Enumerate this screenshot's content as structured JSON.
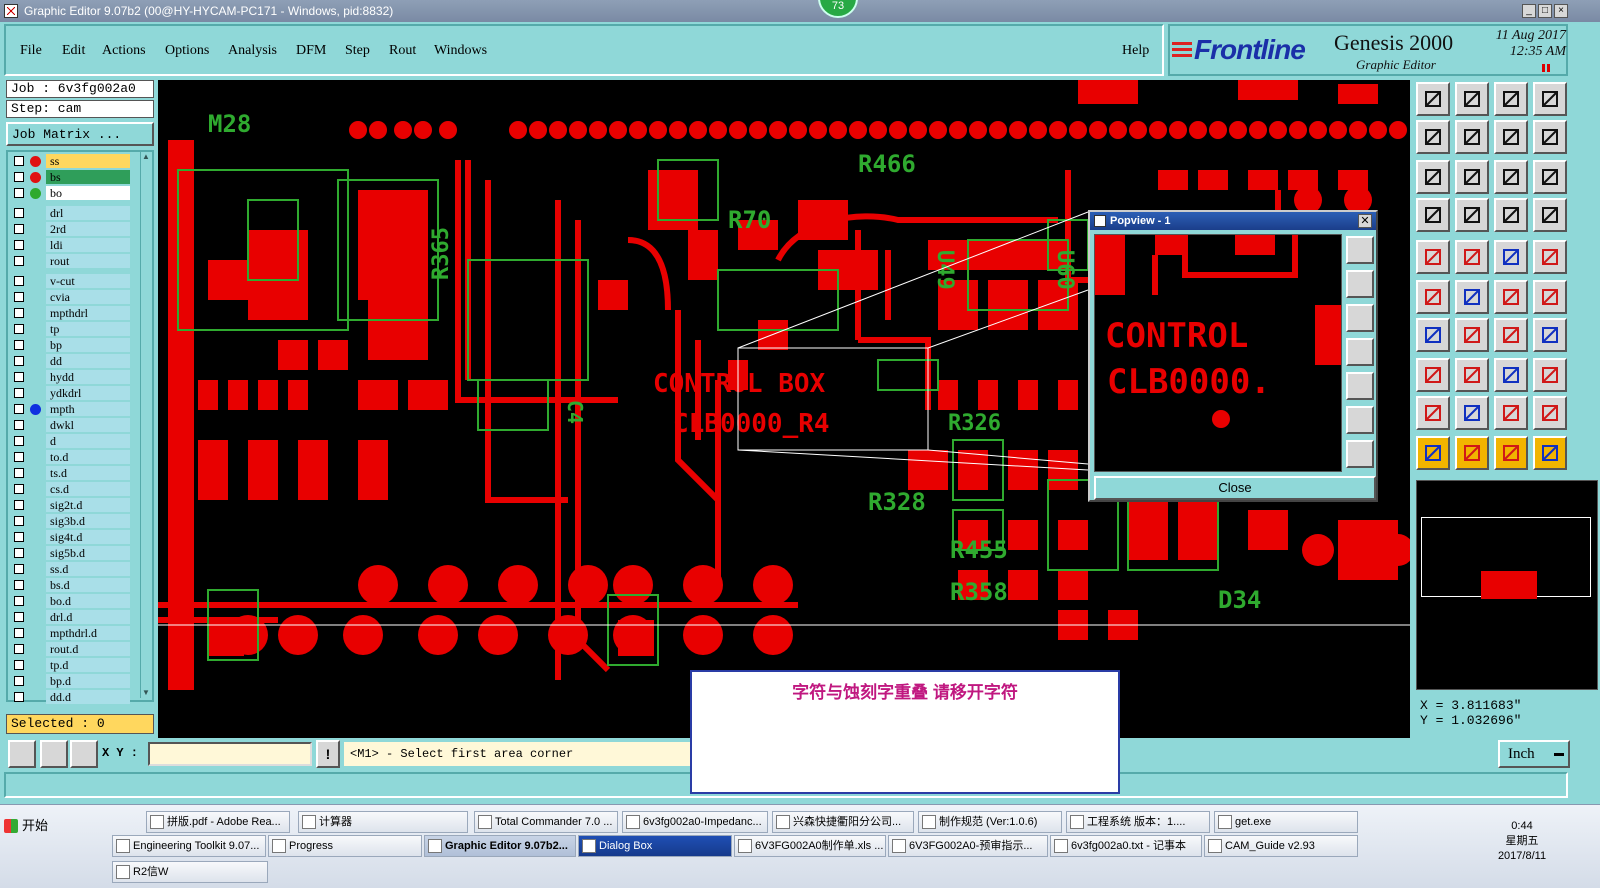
{
  "window": {
    "title": "Graphic Editor 9.07b2 (00@HY-HYCAM-PC171 - Windows, pid:8832)",
    "badge": "73"
  },
  "menu": {
    "items": [
      "File",
      "Edit",
      "Actions",
      "Options",
      "Analysis",
      "DFM",
      "Step",
      "Rout",
      "Windows"
    ],
    "help": "Help"
  },
  "logo": {
    "brand": "Frontline",
    "product": "Genesis 2000",
    "subtitle": "Graphic Editor",
    "date": "11 Aug 2017",
    "time": "12:35 AM"
  },
  "job": {
    "job_label": "Job : 6v3fg002a0",
    "step_label": "Step: cam",
    "matrix_button": "Job Matrix ..."
  },
  "layers": [
    {
      "name": "ss",
      "color": "#ffd75e",
      "dot": "#e01010"
    },
    {
      "name": "bs",
      "color": "#2f9e5a",
      "dot": "#e01010"
    },
    {
      "name": "bo",
      "color": "#ffffff",
      "dot": "#2faa2f"
    },
    {
      "name": "drl",
      "color": "#8fd8d8",
      "dot": ""
    },
    {
      "name": "2rd",
      "color": "#8fd8d8",
      "dot": ""
    },
    {
      "name": "ldi",
      "color": "#8fd8d8",
      "dot": ""
    },
    {
      "name": "rout",
      "color": "#8fd8d8",
      "dot": ""
    },
    {
      "name": "v-cut",
      "color": "#8fd8d8",
      "dot": ""
    },
    {
      "name": "cvia",
      "color": "#8fd8d8",
      "dot": ""
    },
    {
      "name": "mpthdrl",
      "color": "#8fd8d8",
      "dot": ""
    },
    {
      "name": "tp",
      "color": "#8fd8d8",
      "dot": ""
    },
    {
      "name": "bp",
      "color": "#8fd8d8",
      "dot": ""
    },
    {
      "name": "dd",
      "color": "#8fd8d8",
      "dot": ""
    },
    {
      "name": "hydd",
      "color": "#8fd8d8",
      "dot": ""
    },
    {
      "name": "ydkdrl",
      "color": "#8fd8d8",
      "dot": ""
    },
    {
      "name": "mpth",
      "color": "#8fd8d8",
      "dot": "#1030e0"
    },
    {
      "name": "dwkl",
      "color": "#8fd8d8",
      "dot": ""
    },
    {
      "name": "d",
      "color": "#8fd8d8",
      "dot": ""
    },
    {
      "name": "to.d",
      "color": "#8fd8d8",
      "dot": ""
    },
    {
      "name": "ts.d",
      "color": "#8fd8d8",
      "dot": ""
    },
    {
      "name": "cs.d",
      "color": "#8fd8d8",
      "dot": ""
    },
    {
      "name": "sig2t.d",
      "color": "#8fd8d8",
      "dot": ""
    },
    {
      "name": "sig3b.d",
      "color": "#8fd8d8",
      "dot": ""
    },
    {
      "name": "sig4t.d",
      "color": "#8fd8d8",
      "dot": ""
    },
    {
      "name": "sig5b.d",
      "color": "#8fd8d8",
      "dot": ""
    },
    {
      "name": "ss.d",
      "color": "#8fd8d8",
      "dot": ""
    },
    {
      "name": "bs.d",
      "color": "#8fd8d8",
      "dot": ""
    },
    {
      "name": "bo.d",
      "color": "#8fd8d8",
      "dot": ""
    },
    {
      "name": "drl.d",
      "color": "#8fd8d8",
      "dot": ""
    },
    {
      "name": "mpthdrl.d",
      "color": "#8fd8d8",
      "dot": ""
    },
    {
      "name": "rout.d",
      "color": "#8fd8d8",
      "dot": ""
    },
    {
      "name": "tp.d",
      "color": "#8fd8d8",
      "dot": ""
    },
    {
      "name": "bp.d",
      "color": "#8fd8d8",
      "dot": ""
    },
    {
      "name": "dd.d",
      "color": "#8fd8d8",
      "dot": ""
    }
  ],
  "selected": "Selected : 0",
  "canvas": {
    "labels_green": [
      "M28",
      "R466",
      "R70",
      "R365",
      "R328",
      "R455",
      "R358",
      "D34",
      "R326",
      "U60",
      "U49",
      "C4"
    ],
    "labels_red": [
      "CONTROL BOX",
      "CLB0000_R4"
    ]
  },
  "popview": {
    "title": "Popview - 1",
    "text1": "CONTROL",
    "text2": "CLB0000.",
    "close": "Close"
  },
  "coords": {
    "x": "X = 3.811683\"",
    "y": "Y = 1.032696\""
  },
  "dialog": {
    "message": "字符与蚀刻字重叠    请移开字符"
  },
  "status": {
    "xy_label": "X Y :",
    "bang": "!",
    "prompt": "<M1> - Select first area corner",
    "units": "Inch"
  },
  "taskbar": {
    "start": "开始",
    "row1": [
      "拼版.pdf - Adobe Rea...",
      "计算器",
      "Total Commander 7.0 ...",
      "6v3fg002a0-Impedanc...",
      "兴森快捷衢阳分公司...",
      "制作规范 (Ver:1.0.6)",
      "工程系统  版本：1....",
      "get.exe"
    ],
    "row2": [
      "Engineering Toolkit 9.07...",
      "Progress",
      "Graphic Editor 9.07b2...",
      "Dialog Box",
      "6V3FG002A0制作单.xls ...",
      "6V3FG002A0-预审指示...",
      "6v3fg002a0.txt - 记事本",
      "CAM_Guide v2.93"
    ],
    "row3": [
      "R2信W"
    ],
    "clock_time": "0:44",
    "clock_day": "星期五",
    "clock_date": "2017/8/11"
  }
}
